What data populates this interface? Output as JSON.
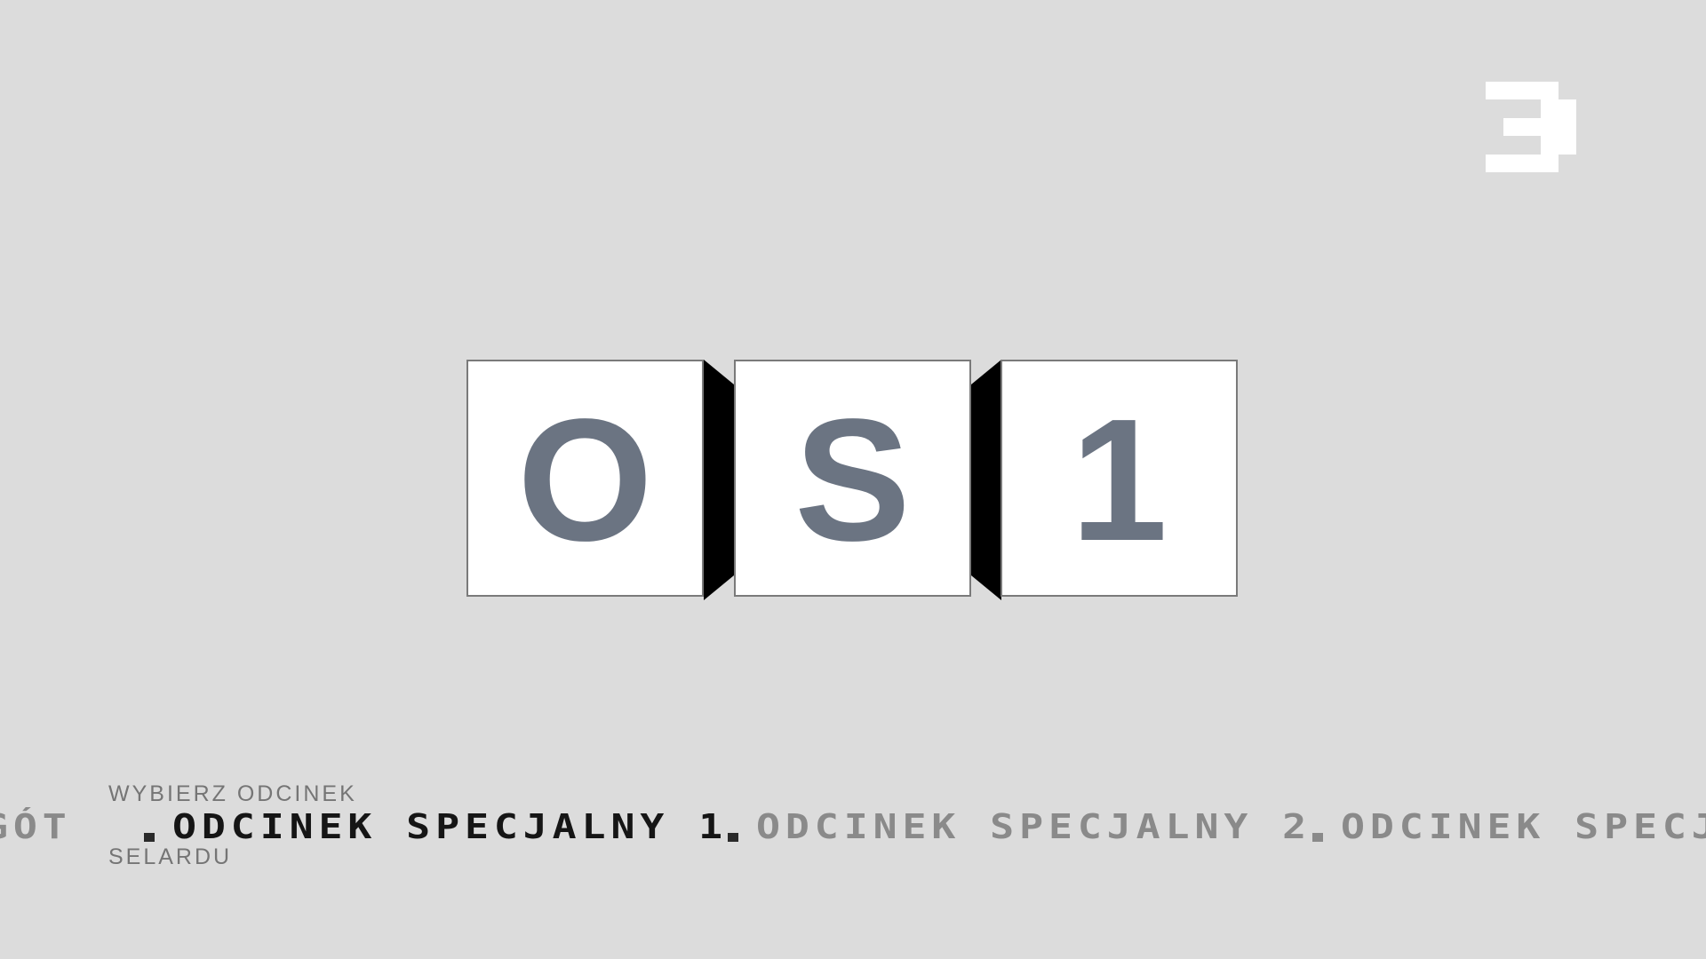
{
  "logo": {
    "icon": "three-logo-icon",
    "color": "#ffffff"
  },
  "display": {
    "tiles": [
      "O",
      "S",
      "1"
    ],
    "tile_text_color": "#6b7482"
  },
  "selector": {
    "label_top": "WYBIERZ ODCINEK",
    "label_bottom": "SELARDU",
    "episodes": [
      {
        "label": "GÓT",
        "active": false
      },
      {
        "label": "ODCINEK SPECJALNY 1",
        "active": true
      },
      {
        "label": "ODCINEK SPECJALNY 2",
        "active": false
      },
      {
        "label": "ODCINEK SPECJALI",
        "active": false
      }
    ]
  }
}
